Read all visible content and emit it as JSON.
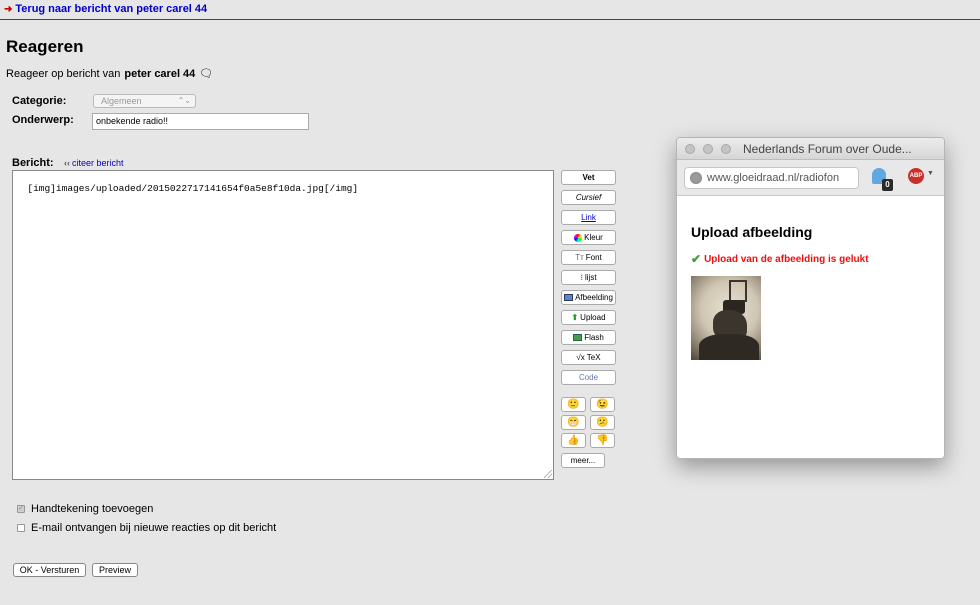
{
  "header": {
    "back_link": "Terug naar bericht van peter carel 44"
  },
  "page": {
    "title": "Reageren",
    "subtitle_prefix": "Reageer op bericht van",
    "subtitle_author": "peter carel 44"
  },
  "form": {
    "category_label": "Categorie:",
    "category_value": "Algemeen",
    "subject_label": "Onderwerp:",
    "subject_value": "onbekende radio!!",
    "message_label": "Bericht:",
    "quote_link": "citeer bericht",
    "message_value": "[img]images/uploaded/2015022717141654f0a5e8f10da.jpg[/img]"
  },
  "toolbar": {
    "bold": "Vet",
    "italic": "Cursief",
    "link": "Link",
    "color": "Kleur",
    "font": "Font",
    "list": "lijst",
    "image": "Afbeelding",
    "upload": "Upload",
    "flash": "Flash",
    "tex": "TeX",
    "code": "Code",
    "more": "meer..."
  },
  "options": {
    "signature_label": "Handtekening toevoegen",
    "signature_checked": true,
    "email_label": "E-mail ontvangen bij nieuwe reacties op dit bericht",
    "email_checked": false
  },
  "actions": {
    "submit": "OK - Versturen",
    "preview": "Preview"
  },
  "popup": {
    "window_title": "Nederlands Forum over Oude...",
    "url": "www.gloeidraad.nl/radiofon",
    "ghostery_count": "0",
    "adblock_label": "ABP",
    "heading": "Upload afbeelding",
    "success_message": "Upload van de afbeelding is gelukt"
  }
}
